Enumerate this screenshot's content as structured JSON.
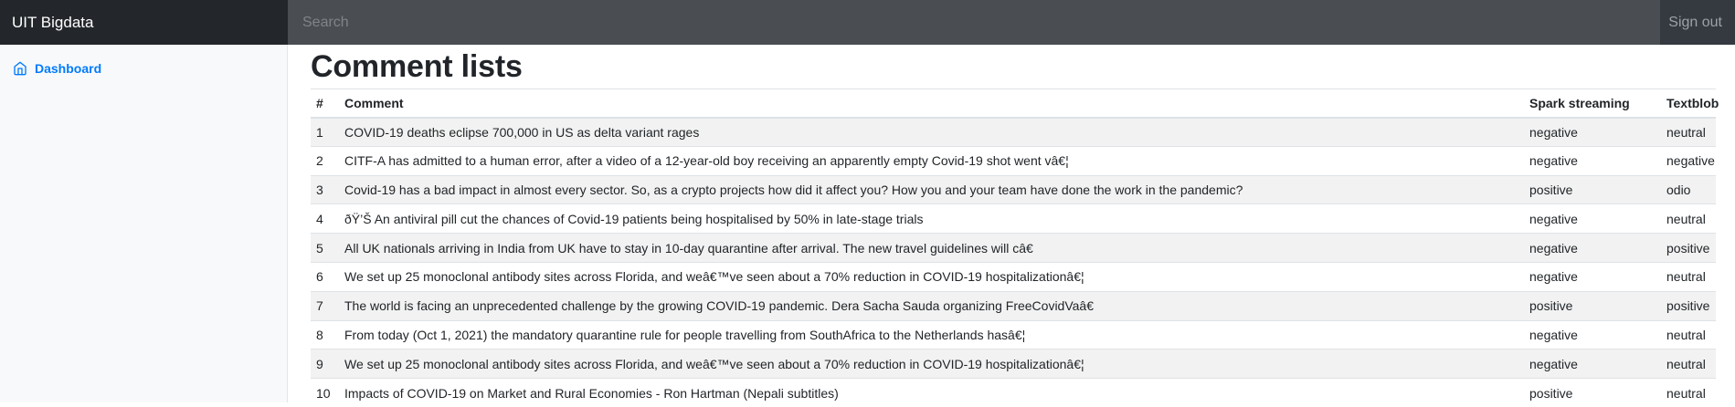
{
  "navbar": {
    "brand": "UIT Bigdata",
    "search_placeholder": "Search",
    "signout_label": "Sign out"
  },
  "sidebar": {
    "items": [
      {
        "label": "Dashboard",
        "icon": "home-icon",
        "active": true
      }
    ]
  },
  "colors": {
    "navbar_bg": "#343a40",
    "brand_bg": "#23272b",
    "link": "#007bff",
    "stripe": "#f2f2f2"
  },
  "main": {
    "title": "Comment lists",
    "table": {
      "headers": [
        "#",
        "Comment",
        "Spark streaming",
        "Textblob"
      ],
      "rows": [
        [
          "1",
          "COVID-19 deaths eclipse 700,000 in US as delta variant rages",
          "negative",
          "neutral"
        ],
        [
          "2",
          "CITF-A has admitted to a human error, after a video of a 12-year-old boy receiving an apparently empty Covid-19 shot went vâ€¦",
          "negative",
          "negative"
        ],
        [
          "3",
          "Covid-19 has a bad impact in almost every sector. So, as a crypto projects how did it affect you? How you and your team have done the work in the pandemic?",
          "positive",
          "odio"
        ],
        [
          "4",
          "ðŸ’Š An antiviral pill cut the chances of Covid-19 patients being hospitalised by 50% in late-stage trials",
          "negative",
          "neutral"
        ],
        [
          "5",
          "All UK nationals arriving in India from UK have to stay in 10-day quarantine after arrival. The new travel guidelines will câ€",
          "negative",
          "positive"
        ],
        [
          "6",
          "We set up 25 monoclonal antibody sites across Florida, and weâ€™ve seen about a 70% reduction in COVID-19 hospitalizationâ€¦",
          "negative",
          "neutral"
        ],
        [
          "7",
          "The world is facing an unprecedented challenge by the growing COVID-19 pandemic. Dera Sacha Sauda organizing FreeCovidVaâ€",
          "positive",
          "positive"
        ],
        [
          "8",
          "From today (Oct 1, 2021) the mandatory quarantine rule for people travelling from SouthAfrica to the Netherlands hasâ€¦",
          "negative",
          "neutral"
        ],
        [
          "9",
          "We set up 25 monoclonal antibody sites across Florida, and weâ€™ve seen about a 70% reduction in COVID-19 hospitalizationâ€¦",
          "negative",
          "neutral"
        ],
        [
          "10",
          "Impacts of COVID-19 on Market and Rural Economies - Ron Hartman (Nepali subtitles)",
          "positive",
          "neutral"
        ]
      ]
    }
  }
}
